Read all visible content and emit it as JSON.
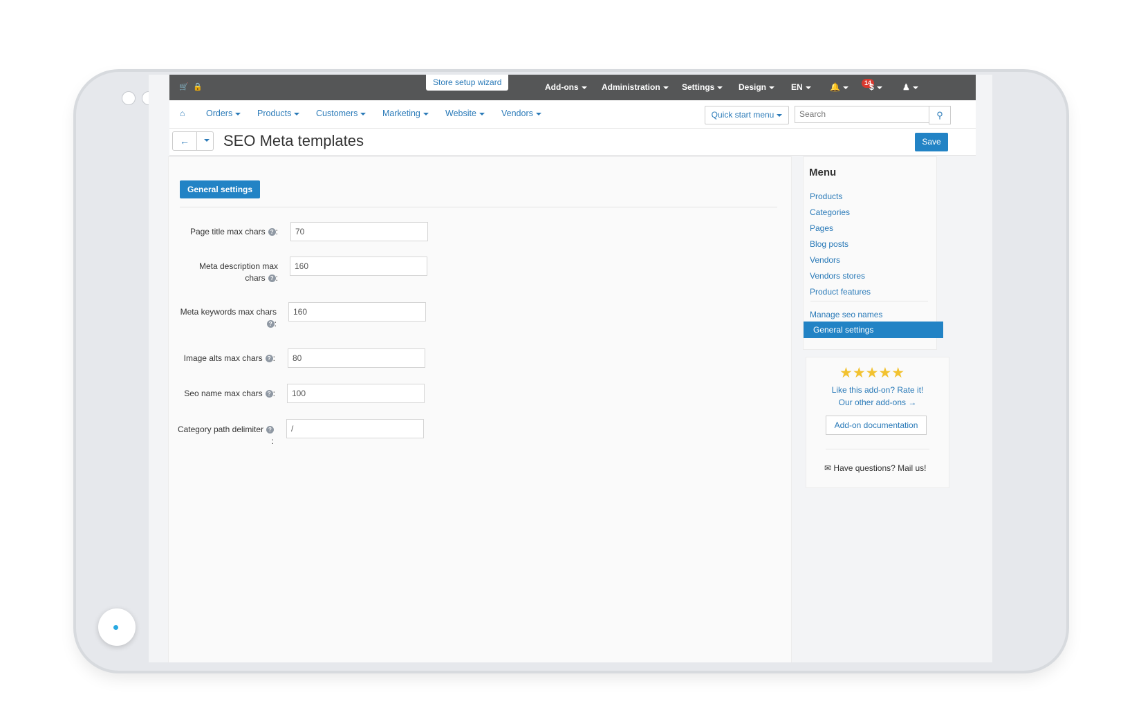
{
  "topbar": {
    "wizard": "Store setup wizard",
    "menus": [
      "Add-ons",
      "Administration",
      "Settings",
      "Design",
      "EN"
    ],
    "notifications_count": "14",
    "currency": "$"
  },
  "nav": {
    "items": [
      "Orders",
      "Products",
      "Customers",
      "Marketing",
      "Website",
      "Vendors"
    ],
    "quick_start": "Quick start menu",
    "search_placeholder": "Search"
  },
  "page": {
    "title": "SEO Meta templates",
    "save_label": "Save",
    "tab_label": "General settings"
  },
  "form": {
    "fields": [
      {
        "label": "Page title max chars",
        "value": "70"
      },
      {
        "label_line1": "Meta description max",
        "label_line2": "chars",
        "value": "160"
      },
      {
        "label_line1": "Meta keywords max chars",
        "value": "160"
      },
      {
        "label": "Image alts max chars",
        "value": "80"
      },
      {
        "label": "Seo name max chars",
        "value": "100"
      },
      {
        "label": "Category path delimiter",
        "value": "/"
      }
    ],
    "colon": ":"
  },
  "sidebar": {
    "title": "Menu",
    "items": [
      "Products",
      "Categories",
      "Pages",
      "Blog posts",
      "Vendors",
      "Vendors stores",
      "Product features"
    ],
    "manage": "Manage seo names",
    "active": "General settings"
  },
  "rate": {
    "stars": "★★★★★",
    "rate_text": "Like this add-on? Rate it!",
    "other_text": "Our other add-ons →",
    "doc_button": "Add-on documentation",
    "mail_text": "Have questions? Mail us!"
  },
  "colors": {
    "accent": "#2283c5",
    "topbar": "#555657",
    "link": "#2a7ab8"
  }
}
